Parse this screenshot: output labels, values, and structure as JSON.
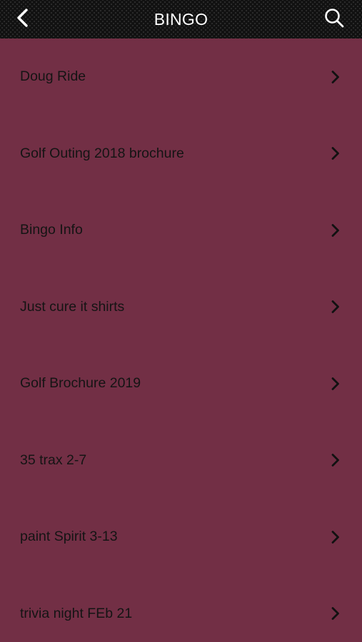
{
  "header": {
    "title": "BINGO",
    "back_icon": "chevron-left-icon",
    "search_icon": "search-icon"
  },
  "colors": {
    "header_background": "#111111",
    "list_background": "#722f45",
    "title_text": "#ffffff",
    "item_text": "#141414"
  },
  "list": {
    "items": [
      {
        "label": "Doug Ride"
      },
      {
        "label": "Golf Outing 2018 brochure"
      },
      {
        "label": "Bingo Info"
      },
      {
        "label": "Just cure it shirts"
      },
      {
        "label": "Golf Brochure 2019"
      },
      {
        "label": "35 trax 2-7"
      },
      {
        "label": "paint Spirit 3-13"
      },
      {
        "label": "trivia night FEb 21"
      }
    ]
  }
}
